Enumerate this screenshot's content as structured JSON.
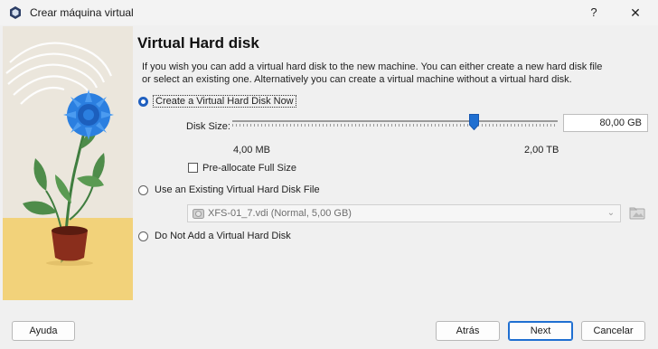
{
  "window": {
    "title": "Crear máquina virtual",
    "help_glyph": "?",
    "close_glyph": "✕"
  },
  "page": {
    "heading": "Virtual Hard disk",
    "description": "If you wish you can add a virtual hard disk to the new machine. You can either create a new hard disk file or select an existing one. Alternatively you can create a virtual machine without a virtual hard disk."
  },
  "options": {
    "create_now": {
      "label": "Create a Virtual Hard Disk Now",
      "selected": true
    },
    "use_existing": {
      "label": "Use an Existing Virtual Hard Disk File",
      "selected": false
    },
    "no_disk": {
      "label": "Do Not Add a Virtual Hard Disk",
      "selected": false
    }
  },
  "disk_size": {
    "label": "Disk Size:",
    "value": "80,00 GB",
    "min_label": "4,00 MB",
    "max_label": "2,00 TB",
    "slider_fraction": 0.74
  },
  "preallocate": {
    "label": "Pre-allocate Full Size",
    "checked": false
  },
  "existing_file": {
    "value": "XFS-01_7.vdi (Normal, 5,00 GB)",
    "enabled": false
  },
  "buttons": {
    "help": "Ayuda",
    "back": "Atrás",
    "next": "Next",
    "cancel": "Cancelar"
  },
  "colors": {
    "accent": "#1f5fbf",
    "flower": "#2b7fe0",
    "leaf": "#4a8a4a",
    "pot": "#8a2e1c",
    "ground": "#f2d27a"
  },
  "icons": {
    "app": "virtualbox-icon",
    "disk": "hard-disk-icon",
    "folder": "folder-open-icon",
    "dropdown": "chevron-down-icon"
  }
}
